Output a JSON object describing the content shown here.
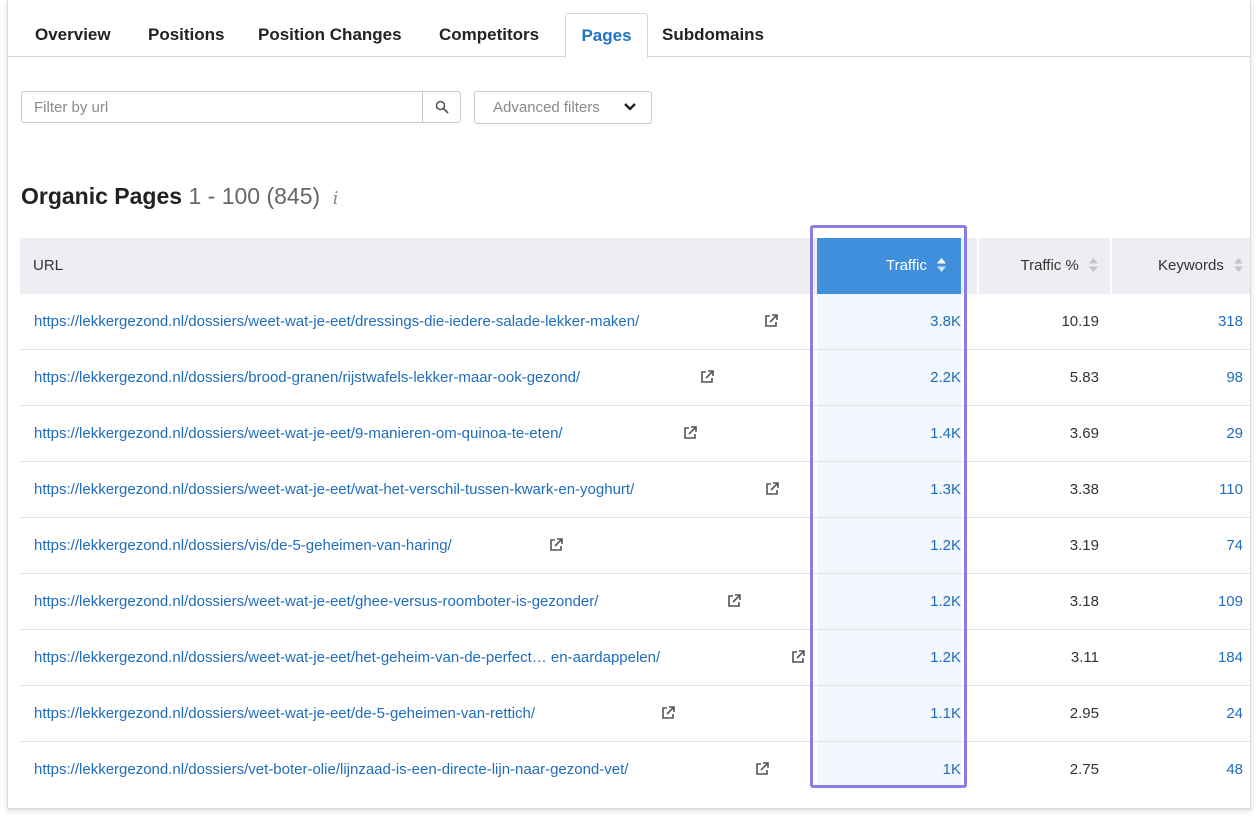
{
  "tabs": [
    {
      "label": "Overview",
      "active": false
    },
    {
      "label": "Positions",
      "active": false
    },
    {
      "label": "Position Changes",
      "active": false
    },
    {
      "label": "Competitors",
      "active": false
    },
    {
      "label": "Pages",
      "active": true
    },
    {
      "label": "Subdomains",
      "active": false
    }
  ],
  "filter": {
    "placeholder": "Filter by url",
    "value": "",
    "advanced_label": "Advanced filters"
  },
  "heading": {
    "title": "Organic Pages",
    "range": "1 - 100 (845)",
    "info": "i"
  },
  "table": {
    "columns": {
      "url": "URL",
      "traffic": "Traffic",
      "traffic_pct": "Traffic %",
      "keywords": "Keywords"
    },
    "rows": [
      {
        "url": "https://lekkergezond.nl/dossiers/weet-wat-je-eet/dressings-die-iedere-salade-lekker-maken/",
        "traffic": "3.8K",
        "traffic_pct": "10.19",
        "keywords": "318"
      },
      {
        "url": "https://lekkergezond.nl/dossiers/brood-granen/rijstwafels-lekker-maar-ook-gezond/",
        "traffic": "2.2K",
        "traffic_pct": "5.83",
        "keywords": "98"
      },
      {
        "url": "https://lekkergezond.nl/dossiers/weet-wat-je-eet/9-manieren-om-quinoa-te-eten/",
        "traffic": "1.4K",
        "traffic_pct": "3.69",
        "keywords": "29"
      },
      {
        "url": "https://lekkergezond.nl/dossiers/weet-wat-je-eet/wat-het-verschil-tussen-kwark-en-yoghurt/",
        "traffic": "1.3K",
        "traffic_pct": "3.38",
        "keywords": "110"
      },
      {
        "url": "https://lekkergezond.nl/dossiers/vis/de-5-geheimen-van-haring/",
        "traffic": "1.2K",
        "traffic_pct": "3.19",
        "keywords": "74"
      },
      {
        "url": "https://lekkergezond.nl/dossiers/weet-wat-je-eet/ghee-versus-roomboter-is-gezonder/",
        "traffic": "1.2K",
        "traffic_pct": "3.18",
        "keywords": "109"
      },
      {
        "url": "https://lekkergezond.nl/dossiers/weet-wat-je-eet/het-geheim-van-de-perfect… en-aardappelen/",
        "traffic": "1.2K",
        "traffic_pct": "3.11",
        "keywords": "184"
      },
      {
        "url": "https://lekkergezond.nl/dossiers/weet-wat-je-eet/de-5-geheimen-van-rettich/",
        "traffic": "1.1K",
        "traffic_pct": "2.95",
        "keywords": "24"
      },
      {
        "url": "https://lekkergezond.nl/dossiers/vet-boter-olie/lijnzaad-is-een-directe-lijn-naar-gezond-vet/",
        "traffic": "1K",
        "traffic_pct": "2.75",
        "keywords": "48"
      }
    ]
  },
  "colors": {
    "accent": "#1f73c9",
    "link": "#1f6dbd",
    "sorted_header": "#3f8fdc",
    "highlight_border": "#8a7ee6"
  },
  "icons": {
    "search": "search-icon",
    "chevron": "chevron-down-icon",
    "external": "external-link-icon",
    "sort": "sort-icon",
    "info": "info-icon"
  }
}
